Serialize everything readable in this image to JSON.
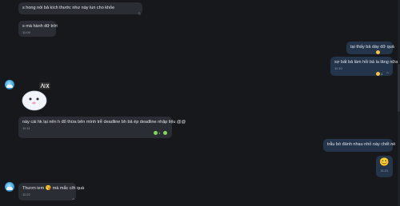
{
  "colors": {
    "background": "#16181c",
    "incoming_bubble": "#2a2d33",
    "outgoing_bubble": "#23344b",
    "timestamp": "#9aa3ad",
    "reaction_yellow": "#f5c542",
    "reaction_green": "#7ed957"
  },
  "messages": [
    {
      "text": "s hong nói bả kích thước như này lun cho khỏe"
    },
    {
      "text": "s mà hành dữ trời",
      "time": "11:09"
    },
    {
      "text": "tại thấy bả dày dữ quá"
    },
    {
      "text": "sợ bất bả làm hỏi bả la lăng nữa",
      "time": "11:10",
      "reaction_count": "1"
    },
    {
      "sticker_caption": "sticker",
      "sticker_icon": "cute-bunny-sticker"
    },
    {
      "text": "này cái hk lại nên h đổ thừa bên mình trễ deadline bh bả ép deadline nhập liệu @@",
      "time": "11:11",
      "reaction_count": "1"
    },
    {
      "text": "trẫu bò đánh nhau nhỏ này chết nè"
    },
    {
      "emoji": "😊",
      "time": "11:21"
    },
    {
      "text": "Thươn iem",
      "emoji": "😘",
      "text_after": "mà mắc cỡi quá",
      "time": "11:22"
    }
  ]
}
